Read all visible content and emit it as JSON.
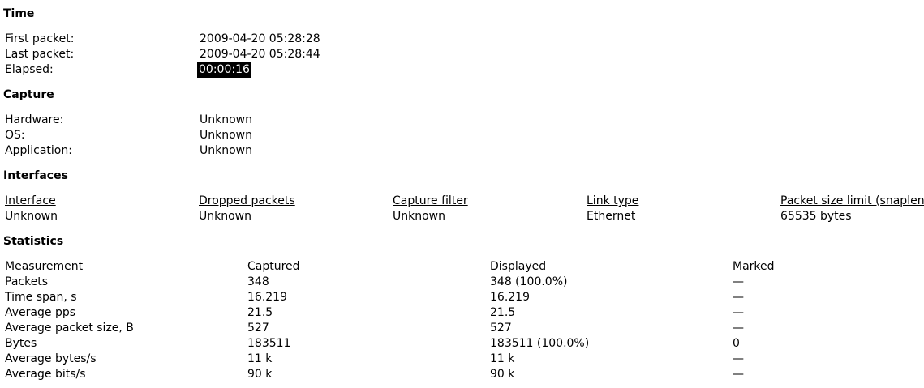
{
  "time": {
    "title": "Time",
    "first_label": "First packet:",
    "first_value": "2009-04-20 05:28:28",
    "last_label": "Last packet:",
    "last_value": "2009-04-20 05:28:44",
    "elapsed_label": "Elapsed:",
    "elapsed_value": "00:00:16"
  },
  "capture": {
    "title": "Capture",
    "hardware_label": "Hardware:",
    "hardware_value": "Unknown",
    "os_label": "OS:",
    "os_value": "Unknown",
    "app_label": "Application:",
    "app_value": "Unknown"
  },
  "interfaces": {
    "title": "Interfaces",
    "headers": [
      "Interface",
      "Dropped packets",
      "Capture filter",
      "Link type",
      "Packet size limit (snaplen)"
    ],
    "row": [
      "Unknown",
      "Unknown",
      "Unknown",
      "Ethernet",
      "65535 bytes"
    ]
  },
  "statistics": {
    "title": "Statistics",
    "headers": [
      "Measurement",
      "Captured",
      "Displayed",
      "Marked"
    ],
    "rows": [
      [
        "Packets",
        "348",
        "348 (100.0%)",
        "—"
      ],
      [
        "Time span, s",
        "16.219",
        "16.219",
        "—"
      ],
      [
        "Average pps",
        "21.5",
        "21.5",
        "—"
      ],
      [
        "Average packet size, B",
        "527",
        "527",
        "—"
      ],
      [
        "Bytes",
        "183511",
        "183511 (100.0%)",
        "0"
      ],
      [
        "Average bytes/s",
        "11 k",
        "11 k",
        "—"
      ],
      [
        "Average bits/s",
        "90 k",
        "90 k",
        "—"
      ]
    ]
  }
}
